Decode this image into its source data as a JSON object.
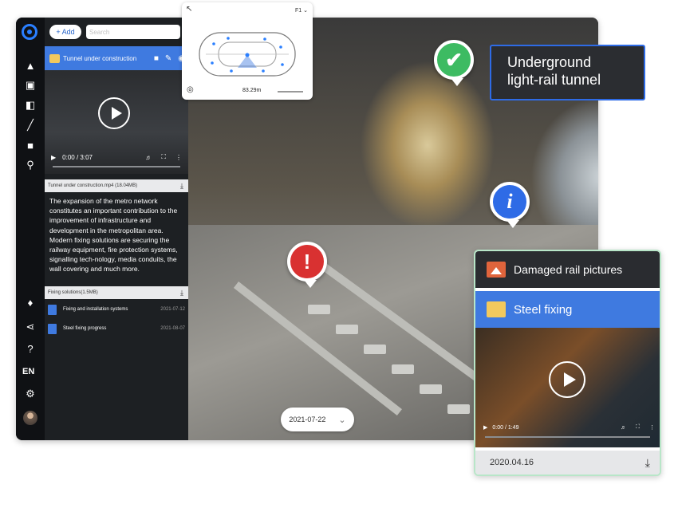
{
  "toolbar": {
    "add_label": "+ Add",
    "search_placeholder": "Search"
  },
  "sidebar": {
    "lang": "EN"
  },
  "video_item": {
    "title": "Tunnel under construction",
    "time": "0:00 / 3:07",
    "file_name": "Tunnel under construction.mp4 (18.04MB)"
  },
  "description": "The expansion of the metro network constitutes an important contribution to the improvement of infrastructure and development in the metropolitan area. Modern fixing solutions are securing the railway equipment, fire protection systems, signalling tech-nology, media conduits, the wall covering and much more.",
  "attachment": {
    "file_name": "Fixing solutions(1.5MB)"
  },
  "documents": [
    {
      "name": "Fixing and installation systems",
      "date": "2021-07-12"
    },
    {
      "name": "Steel fixing progress",
      "date": "2021-08-07"
    }
  ],
  "map": {
    "floor": "F1",
    "scale": "83.29m"
  },
  "callout": {
    "line1": "Underground",
    "line2": "light-rail tunnel"
  },
  "card": {
    "item1": "Damaged rail pictures",
    "item2": "Steel fixing",
    "time": "0:00 / 1:49",
    "date": "2020.04.16"
  },
  "timeline": {
    "date": "2021-07-22"
  },
  "colors": {
    "accent": "#3f7ae0",
    "check": "#3dbb62",
    "warning": "#d93131",
    "info": "#2e6be6"
  }
}
